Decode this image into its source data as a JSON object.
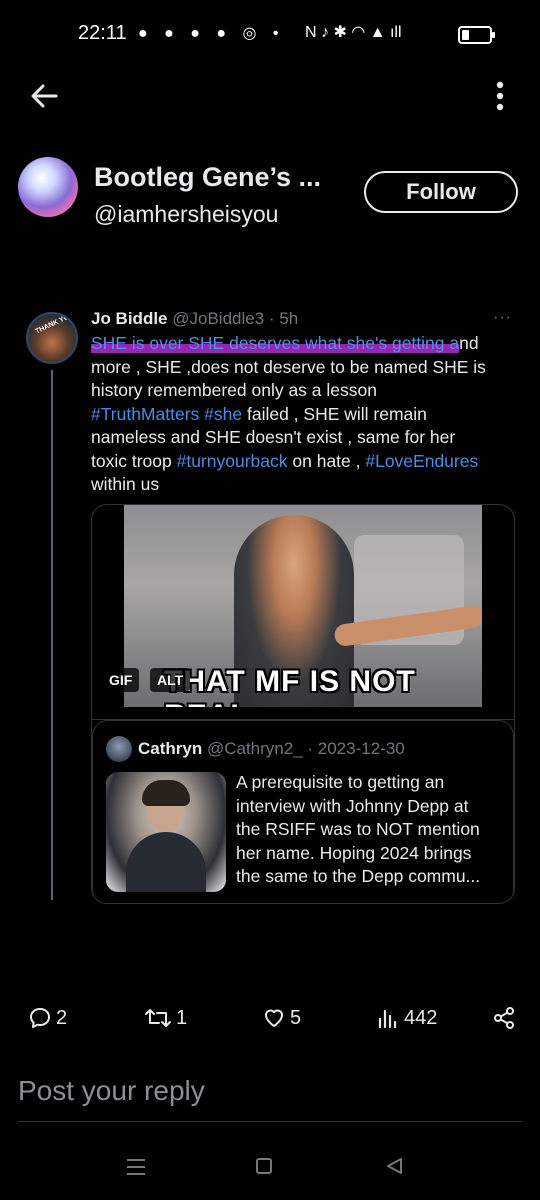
{
  "status_bar": {
    "time": "22:11",
    "notif_icons": "● ● ● ● ◎ •",
    "right_icons": "N ♪ ✱ ◠ ▲ ıll"
  },
  "nav": {
    "back_icon": "arrow-left-icon",
    "more_icon": "vertical-dots-icon"
  },
  "profile": {
    "display_name": "Bootleg Gene’s ...",
    "handle": "@iamhersheisyou",
    "follow_label": "Follow"
  },
  "quoted_tweet": {
    "avatar_text": "THANK YOU",
    "name": "Jo Biddle",
    "meta": "@JoBiddle3 · 5h",
    "more": "···",
    "lines": {
      "l1_highlight": "SHE is over SHE deserves what she's getting a",
      "l1_rest": "nd",
      "l2": "more , SHE ,does not deserve to be named SHE is",
      "l3": "history remembered only as a lesson",
      "l4_tag1": "#TruthMatters",
      "l4_tag2": "#she",
      "l4_rest": " failed , SHE will remain",
      "l5": "nameless and SHE doesn't exist , same for her",
      "l6_pre": "toxic troop ",
      "l6_tag1": "#turnyourback",
      "l6_mid": " on hate , ",
      "l6_tag2": "#LoveEndures",
      "l7": "within us"
    },
    "gif": {
      "caption": "THAT MF IS NOT REAL",
      "gif_badge": "GIF",
      "alt_badge": "ALT"
    },
    "inner_quote": {
      "name": "Cathryn",
      "meta": "@Cathryn2_ · 2023-12-30",
      "text_lines": [
        "A prerequisite to getting an",
        "interview with Johnny Depp at",
        "the RSIFF was to NOT mention",
        "her name. Hoping 2024 brings",
        "the same to the Depp commu..."
      ]
    }
  },
  "actions": {
    "replies": "2",
    "reposts": "1",
    "likes": "5",
    "views": "442"
  },
  "reply": {
    "placeholder": "Post your reply"
  }
}
